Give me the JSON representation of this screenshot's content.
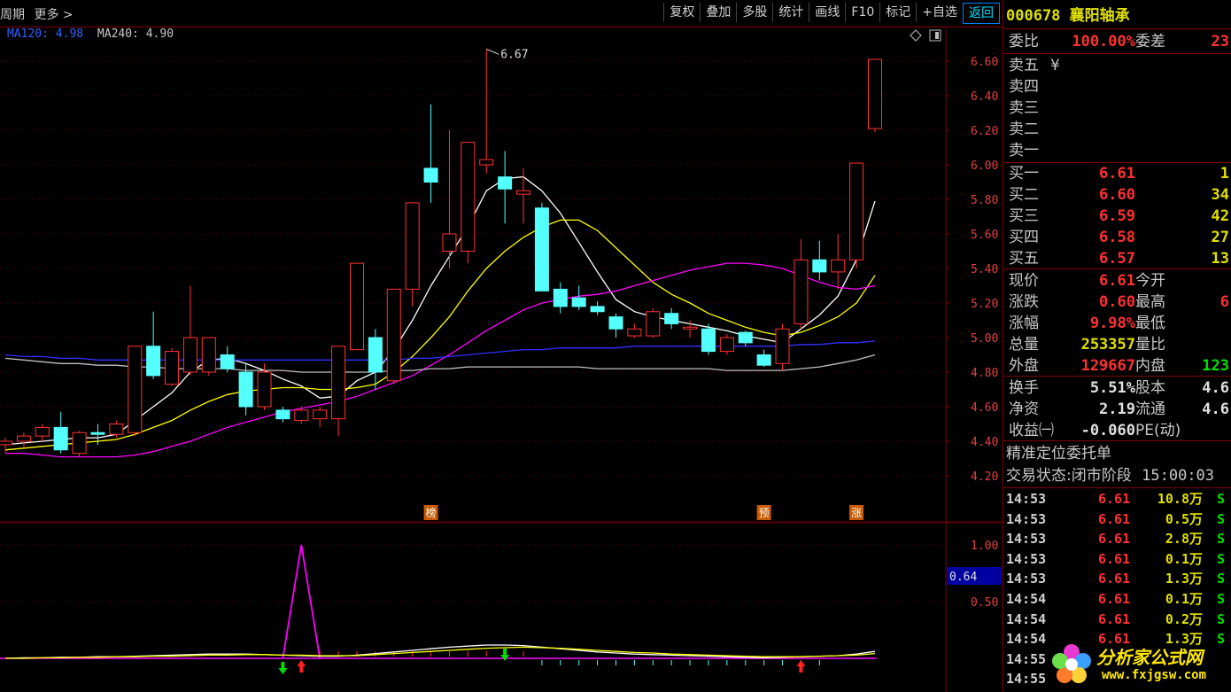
{
  "toolbar": {
    "left_items": [
      "周期",
      "更多 >"
    ],
    "buttons": [
      "复权",
      "叠加",
      "多股",
      "统计",
      "画线",
      "F10",
      "标记",
      "+自选",
      "返回"
    ]
  },
  "ma_legend": {
    "ma120": "MA120: 4.98",
    "ma240": "MA240: 4.90"
  },
  "chart_data": [
    {
      "type": "candlestick",
      "title": "",
      "y_ticks": [
        "6.60",
        "6.40",
        "6.20",
        "6.00",
        "5.80",
        "5.60",
        "5.40",
        "5.20",
        "5.00",
        "4.80",
        "4.60",
        "4.40",
        "4.20"
      ],
      "ylim": [
        4.1,
        6.75
      ],
      "candles": [
        {
          "o": 4.38,
          "c": 4.4,
          "h": 4.42,
          "l": 4.33
        },
        {
          "o": 4.4,
          "c": 4.43,
          "h": 4.45,
          "l": 4.36
        },
        {
          "o": 4.43,
          "c": 4.48,
          "h": 4.5,
          "l": 4.4
        },
        {
          "o": 4.48,
          "c": 4.35,
          "h": 4.57,
          "l": 4.33
        },
        {
          "o": 4.33,
          "c": 4.45,
          "h": 4.46,
          "l": 4.31
        },
        {
          "o": 4.45,
          "c": 4.44,
          "h": 4.5,
          "l": 4.38
        },
        {
          "o": 4.44,
          "c": 4.5,
          "h": 4.52,
          "l": 4.42
        },
        {
          "o": 4.45,
          "c": 4.95,
          "h": 4.95,
          "l": 4.43
        },
        {
          "o": 4.95,
          "c": 4.78,
          "h": 5.15,
          "l": 4.76
        },
        {
          "o": 4.73,
          "c": 4.92,
          "h": 4.94,
          "l": 4.72
        },
        {
          "o": 4.8,
          "c": 5.0,
          "h": 5.3,
          "l": 4.78
        },
        {
          "o": 4.8,
          "c": 5.0,
          "h": 5.0,
          "l": 4.78
        },
        {
          "o": 4.9,
          "c": 4.82,
          "h": 4.95,
          "l": 4.8
        },
        {
          "o": 4.8,
          "c": 4.6,
          "h": 4.85,
          "l": 4.55
        },
        {
          "o": 4.6,
          "c": 4.8,
          "h": 4.85,
          "l": 4.58
        },
        {
          "o": 4.58,
          "c": 4.53,
          "h": 4.6,
          "l": 4.51
        },
        {
          "o": 4.52,
          "c": 4.58,
          "h": 4.6,
          "l": 4.5
        },
        {
          "o": 4.53,
          "c": 4.58,
          "h": 4.6,
          "l": 4.48
        },
        {
          "o": 4.53,
          "c": 4.95,
          "h": 4.95,
          "l": 4.43
        },
        {
          "o": 4.93,
          "c": 5.43,
          "h": 5.43,
          "l": 4.93
        },
        {
          "o": 5.0,
          "c": 4.8,
          "h": 5.05,
          "l": 4.7
        },
        {
          "o": 4.75,
          "c": 5.28,
          "h": 5.28,
          "l": 4.73
        },
        {
          "o": 5.28,
          "c": 5.78,
          "h": 5.78,
          "l": 5.18
        },
        {
          "o": 5.98,
          "c": 5.9,
          "h": 6.35,
          "l": 5.78
        },
        {
          "o": 5.5,
          "c": 5.6,
          "h": 6.2,
          "l": 5.4
        },
        {
          "o": 5.5,
          "c": 6.13,
          "h": 6.13,
          "l": 5.43
        },
        {
          "o": 6.0,
          "c": 6.03,
          "h": 6.67,
          "l": 5.95
        },
        {
          "o": 5.93,
          "c": 5.86,
          "h": 6.08,
          "l": 5.66
        },
        {
          "o": 5.83,
          "c": 5.85,
          "h": 5.98,
          "l": 5.66
        },
        {
          "o": 5.75,
          "c": 5.27,
          "h": 5.78,
          "l": 5.27
        },
        {
          "o": 5.28,
          "c": 5.18,
          "h": 5.32,
          "l": 5.14
        },
        {
          "o": 5.23,
          "c": 5.18,
          "h": 5.3,
          "l": 5.16
        },
        {
          "o": 5.18,
          "c": 5.15,
          "h": 5.21,
          "l": 5.13
        },
        {
          "o": 5.12,
          "c": 5.05,
          "h": 5.14,
          "l": 5.0
        },
        {
          "o": 5.01,
          "c": 5.05,
          "h": 5.08,
          "l": 5.0
        },
        {
          "o": 5.01,
          "c": 5.15,
          "h": 5.17,
          "l": 5.0
        },
        {
          "o": 5.14,
          "c": 5.08,
          "h": 5.17,
          "l": 5.05
        },
        {
          "o": 5.05,
          "c": 5.06,
          "h": 5.1,
          "l": 5.0
        },
        {
          "o": 5.05,
          "c": 4.92,
          "h": 5.08,
          "l": 4.9
        },
        {
          "o": 4.92,
          "c": 5.0,
          "h": 5.02,
          "l": 4.9
        },
        {
          "o": 5.03,
          "c": 4.97,
          "h": 5.04,
          "l": 4.95
        },
        {
          "o": 4.9,
          "c": 4.84,
          "h": 4.93,
          "l": 4.83
        },
        {
          "o": 4.85,
          "c": 5.05,
          "h": 5.08,
          "l": 4.81
        },
        {
          "o": 5.08,
          "c": 5.45,
          "h": 5.57,
          "l": 5.05
        },
        {
          "o": 5.45,
          "c": 5.38,
          "h": 5.56,
          "l": 5.33
        },
        {
          "o": 5.38,
          "c": 5.45,
          "h": 5.6,
          "l": 5.28
        },
        {
          "o": 5.45,
          "c": 6.01,
          "h": 6.01,
          "l": 5.4
        },
        {
          "o": 6.21,
          "c": 6.61,
          "h": 6.61,
          "l": 6.19
        }
      ],
      "ma_lines": [
        {
          "name": "MA5",
          "color": "#ffffff",
          "values": [
            4.38,
            4.39,
            4.4,
            4.41,
            4.42,
            4.42,
            4.44,
            4.52,
            4.6,
            4.68,
            4.8,
            4.87,
            4.88,
            4.85,
            4.81,
            4.76,
            4.72,
            4.65,
            4.66,
            4.75,
            4.8,
            4.93,
            5.1,
            5.3,
            5.47,
            5.64,
            5.85,
            5.92,
            5.93,
            5.85,
            5.72,
            5.55,
            5.38,
            5.22,
            5.15,
            5.12,
            5.1,
            5.08,
            5.06,
            5.04,
            5.01,
            4.99,
            4.97,
            5.05,
            5.13,
            5.24,
            5.45,
            5.79
          ]
        },
        {
          "name": "MA10",
          "color": "#ffff00",
          "values": [
            4.35,
            4.36,
            4.37,
            4.38,
            4.39,
            4.4,
            4.41,
            4.44,
            4.48,
            4.52,
            4.58,
            4.63,
            4.67,
            4.69,
            4.7,
            4.71,
            4.71,
            4.7,
            4.7,
            4.71,
            4.73,
            4.8,
            4.89,
            5.0,
            5.12,
            5.27,
            5.4,
            5.5,
            5.58,
            5.64,
            5.68,
            5.68,
            5.62,
            5.52,
            5.42,
            5.32,
            5.25,
            5.2,
            5.14,
            5.1,
            5.06,
            5.03,
            5.01,
            5.03,
            5.07,
            5.12,
            5.2,
            5.36
          ]
        },
        {
          "name": "MA20",
          "color": "#ff00ff",
          "values": [
            4.33,
            4.33,
            4.32,
            4.31,
            4.31,
            4.31,
            4.31,
            4.32,
            4.34,
            4.37,
            4.4,
            4.44,
            4.48,
            4.51,
            4.54,
            4.57,
            4.59,
            4.61,
            4.63,
            4.66,
            4.7,
            4.74,
            4.78,
            4.84,
            4.9,
            4.97,
            5.04,
            5.1,
            5.16,
            5.2,
            5.22,
            5.24,
            5.25,
            5.27,
            5.3,
            5.33,
            5.36,
            5.39,
            5.41,
            5.43,
            5.43,
            5.42,
            5.4,
            5.36,
            5.32,
            5.29,
            5.28,
            5.3
          ]
        },
        {
          "name": "MA120",
          "color": "#3030ff",
          "values": [
            4.9,
            4.89,
            4.89,
            4.88,
            4.88,
            4.87,
            4.87,
            4.87,
            4.87,
            4.87,
            4.87,
            4.87,
            4.87,
            4.87,
            4.87,
            4.87,
            4.87,
            4.87,
            4.87,
            4.87,
            4.87,
            4.87,
            4.88,
            4.88,
            4.89,
            4.9,
            4.91,
            4.92,
            4.93,
            4.93,
            4.94,
            4.94,
            4.94,
            4.94,
            4.95,
            4.95,
            4.95,
            4.95,
            4.95,
            4.95,
            4.95,
            4.95,
            4.95,
            4.96,
            4.96,
            4.97,
            4.97,
            4.98
          ]
        },
        {
          "name": "MA240",
          "color": "#c0c0c0",
          "values": [
            4.88,
            4.87,
            4.86,
            4.85,
            4.85,
            4.84,
            4.84,
            4.83,
            4.83,
            4.82,
            4.82,
            4.82,
            4.82,
            4.81,
            4.81,
            4.81,
            4.8,
            4.8,
            4.8,
            4.8,
            4.8,
            4.81,
            4.81,
            4.82,
            4.82,
            4.83,
            4.83,
            4.83,
            4.83,
            4.83,
            4.83,
            4.83,
            4.82,
            4.82,
            4.82,
            4.82,
            4.82,
            4.82,
            4.82,
            4.81,
            4.81,
            4.81,
            4.81,
            4.82,
            4.83,
            4.85,
            4.87,
            4.9
          ]
        }
      ],
      "annotations": [
        {
          "text": "6.67",
          "index": 26,
          "value": 6.67
        },
        {
          "text": "榜",
          "index": 23
        },
        {
          "text": "预",
          "index": 41
        },
        {
          "text": "涨",
          "index": 46
        }
      ]
    },
    {
      "type": "line",
      "title": "",
      "y_ticks": [
        "1.00",
        "0.50"
      ],
      "ylim": [
        -0.05,
        1.05
      ],
      "current_value": "0.64",
      "series": [
        {
          "color": "#ffffff",
          "values": [
            0.0,
            0.01,
            0.01,
            0.02,
            0.02,
            0.03,
            0.03,
            0.04,
            0.05,
            0.06,
            0.07,
            0.08,
            0.08,
            0.08,
            0.07,
            0.06,
            0.05,
            0.04,
            0.04,
            0.06,
            0.09,
            0.12,
            0.15,
            0.18,
            0.21,
            0.23,
            0.25,
            0.25,
            0.24,
            0.21,
            0.18,
            0.15,
            0.12,
            0.1,
            0.08,
            0.07,
            0.06,
            0.05,
            0.04,
            0.03,
            0.02,
            0.01,
            0.02,
            0.03,
            0.04,
            0.05,
            0.08,
            0.13
          ]
        },
        {
          "color": "#ffff00",
          "values": [
            0.0,
            0.0,
            0.01,
            0.01,
            0.02,
            0.02,
            0.03,
            0.03,
            0.04,
            0.04,
            0.05,
            0.06,
            0.06,
            0.07,
            0.07,
            0.06,
            0.06,
            0.05,
            0.05,
            0.05,
            0.07,
            0.09,
            0.11,
            0.13,
            0.15,
            0.17,
            0.19,
            0.2,
            0.21,
            0.2,
            0.19,
            0.17,
            0.15,
            0.13,
            0.11,
            0.1,
            0.08,
            0.07,
            0.06,
            0.05,
            0.04,
            0.03,
            0.03,
            0.03,
            0.04,
            0.05,
            0.06,
            0.09
          ]
        }
      ],
      "spike_index": 16,
      "down_arrows": [
        15,
        27
      ],
      "up_arrows": [
        16,
        43
      ]
    }
  ],
  "quote": {
    "code_name": "000678 襄阳轴承",
    "weibi_label": "委比",
    "weibi_value": "100.00%",
    "weicha_label": "委差",
    "weicha_value": "23",
    "sells": [
      {
        "label": "卖五",
        "mark": "¥"
      },
      {
        "label": "卖四",
        "mark": ""
      },
      {
        "label": "卖三",
        "mark": ""
      },
      {
        "label": "卖二",
        "mark": ""
      },
      {
        "label": "卖一",
        "mark": ""
      }
    ],
    "buys": [
      {
        "label": "买一",
        "price": "6.61",
        "vol": "1"
      },
      {
        "label": "买二",
        "price": "6.60",
        "vol": "34"
      },
      {
        "label": "买三",
        "price": "6.59",
        "vol": "42"
      },
      {
        "label": "买四",
        "price": "6.58",
        "vol": "27"
      },
      {
        "label": "买五",
        "price": "6.57",
        "vol": "13"
      }
    ],
    "stats": [
      {
        "l1": "现价",
        "v1": "6.61",
        "l2": "今开",
        "v2": "",
        "c1": "#ff3030",
        "c2": "#ff3030"
      },
      {
        "l1": "涨跌",
        "v1": "0.60",
        "l2": "最高",
        "v2": "6",
        "c1": "#ff3030",
        "c2": "#ff3030"
      },
      {
        "l1": "涨幅",
        "v1": "9.98%",
        "l2": "最低",
        "v2": "",
        "c1": "#ff3030",
        "c2": "#ff3030"
      },
      {
        "l1": "总量",
        "v1": "253357",
        "l2": "量比",
        "v2": "",
        "c1": "#e0e000",
        "c2": "#e0e000"
      },
      {
        "l1": "外盘",
        "v1": "129667",
        "l2": "内盘",
        "v2": "123",
        "c1": "#ff3030",
        "c2": "#00e000"
      }
    ],
    "fin": [
      {
        "l1": "换手",
        "v1": "5.51%",
        "l2": "股本",
        "v2": "4.6"
      },
      {
        "l1": "净资",
        "v1": "2.19",
        "l2": "流通",
        "v2": "4.6"
      },
      {
        "l1": "收益㈠",
        "v1": "-0.060",
        "l2": "PE(动)",
        "v2": ""
      }
    ],
    "order_label": "精准定位委托单",
    "trade_state": "交易状态:闭市阶段",
    "trade_time": "15:00:03",
    "ticks": [
      {
        "t": "14:53",
        "p": "6.61",
        "v": "10.8万",
        "s": "S"
      },
      {
        "t": "14:53",
        "p": "6.61",
        "v": "0.5万",
        "s": "S"
      },
      {
        "t": "14:53",
        "p": "6.61",
        "v": "2.8万",
        "s": "S"
      },
      {
        "t": "14:53",
        "p": "6.61",
        "v": "0.1万",
        "s": "S"
      },
      {
        "t": "14:53",
        "p": "6.61",
        "v": "1.3万",
        "s": "S"
      },
      {
        "t": "14:54",
        "p": "6.61",
        "v": "0.1万",
        "s": "S"
      },
      {
        "t": "14:54",
        "p": "6.61",
        "v": "0.2万",
        "s": "S"
      },
      {
        "t": "14:54",
        "p": "6.61",
        "v": "1.3万",
        "s": "S"
      },
      {
        "t": "14:55",
        "p": "",
        "v": "",
        "s": ""
      },
      {
        "t": "14:55",
        "p": "",
        "v": "",
        "s": ""
      }
    ]
  },
  "watermark": {
    "text": "分析家公式网",
    "url": "www.fxjgsw.com"
  }
}
